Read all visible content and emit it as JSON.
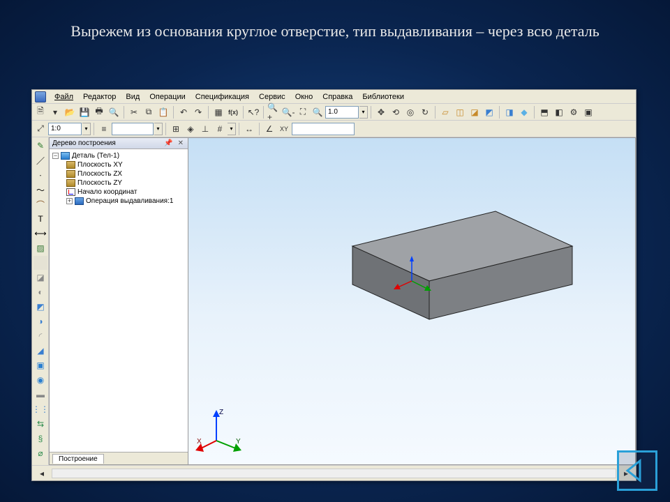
{
  "slide": {
    "title": "Вырежем из основания круглое отверстие, тип выдавливания – через всю деталь"
  },
  "menu": {
    "file": "Файл",
    "edit": "Редактор",
    "view": "Вид",
    "ops": "Операции",
    "spec": "Спецификация",
    "service": "Сервис",
    "window": "Окно",
    "help": "Справка",
    "libs": "Библиотеки"
  },
  "toolbar": {
    "zoom_value": "1.0",
    "scale_value": "1:0",
    "fx_label": "f(x)"
  },
  "tree": {
    "title": "Дерево построения",
    "root": "Деталь (Тел-1)",
    "items": [
      "Плоскость XY",
      "Плоскость ZX",
      "Плоскость ZY",
      "Начало координат",
      "Операция выдавливания:1"
    ],
    "tab": "Построение"
  },
  "axes": {
    "x": "X",
    "y": "Y",
    "z": "Z"
  }
}
